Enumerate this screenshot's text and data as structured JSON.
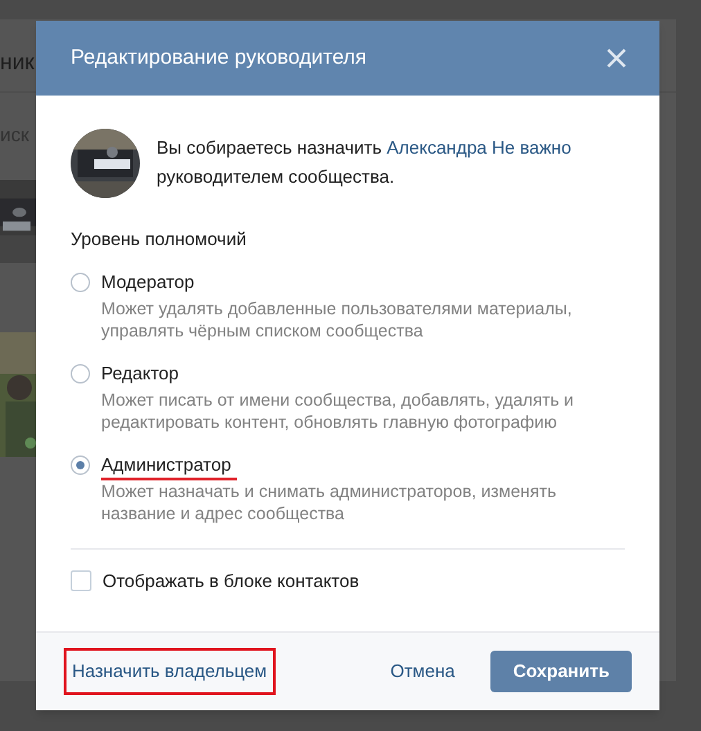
{
  "background_page": {
    "heading": "ник",
    "search": {
      "placeholder": "иск"
    }
  },
  "dialog": {
    "title": "Редактирование руководителя",
    "intro": {
      "text_before": "Вы собираетесь назначить",
      "link": "Александра Не важно",
      "text_after": "руководителем сообщества."
    },
    "section_title": "Уровень полномочий",
    "options": [
      {
        "label": "Модератор",
        "description": "Может удалять добавленные пользователями материалы, управлять чёрным списком сообщества",
        "selected": false,
        "highlighted": false
      },
      {
        "label": "Редактор",
        "description": "Может писать от имени сообщества, добавлять, удалять и редактировать контент, обновлять главную фотографию",
        "selected": false,
        "highlighted": false
      },
      {
        "label": "Администратор",
        "description": "Может назначать и снимать администраторов, изменять название и адрес сообщества",
        "selected": true,
        "highlighted": true
      }
    ],
    "checkbox": {
      "label": "Отображать в блоке контактов",
      "checked": false
    },
    "footer": {
      "owner_link": {
        "label": "Назначить владельцем",
        "highlighted": true
      },
      "cancel": "Отмена",
      "save": "Сохранить"
    }
  }
}
